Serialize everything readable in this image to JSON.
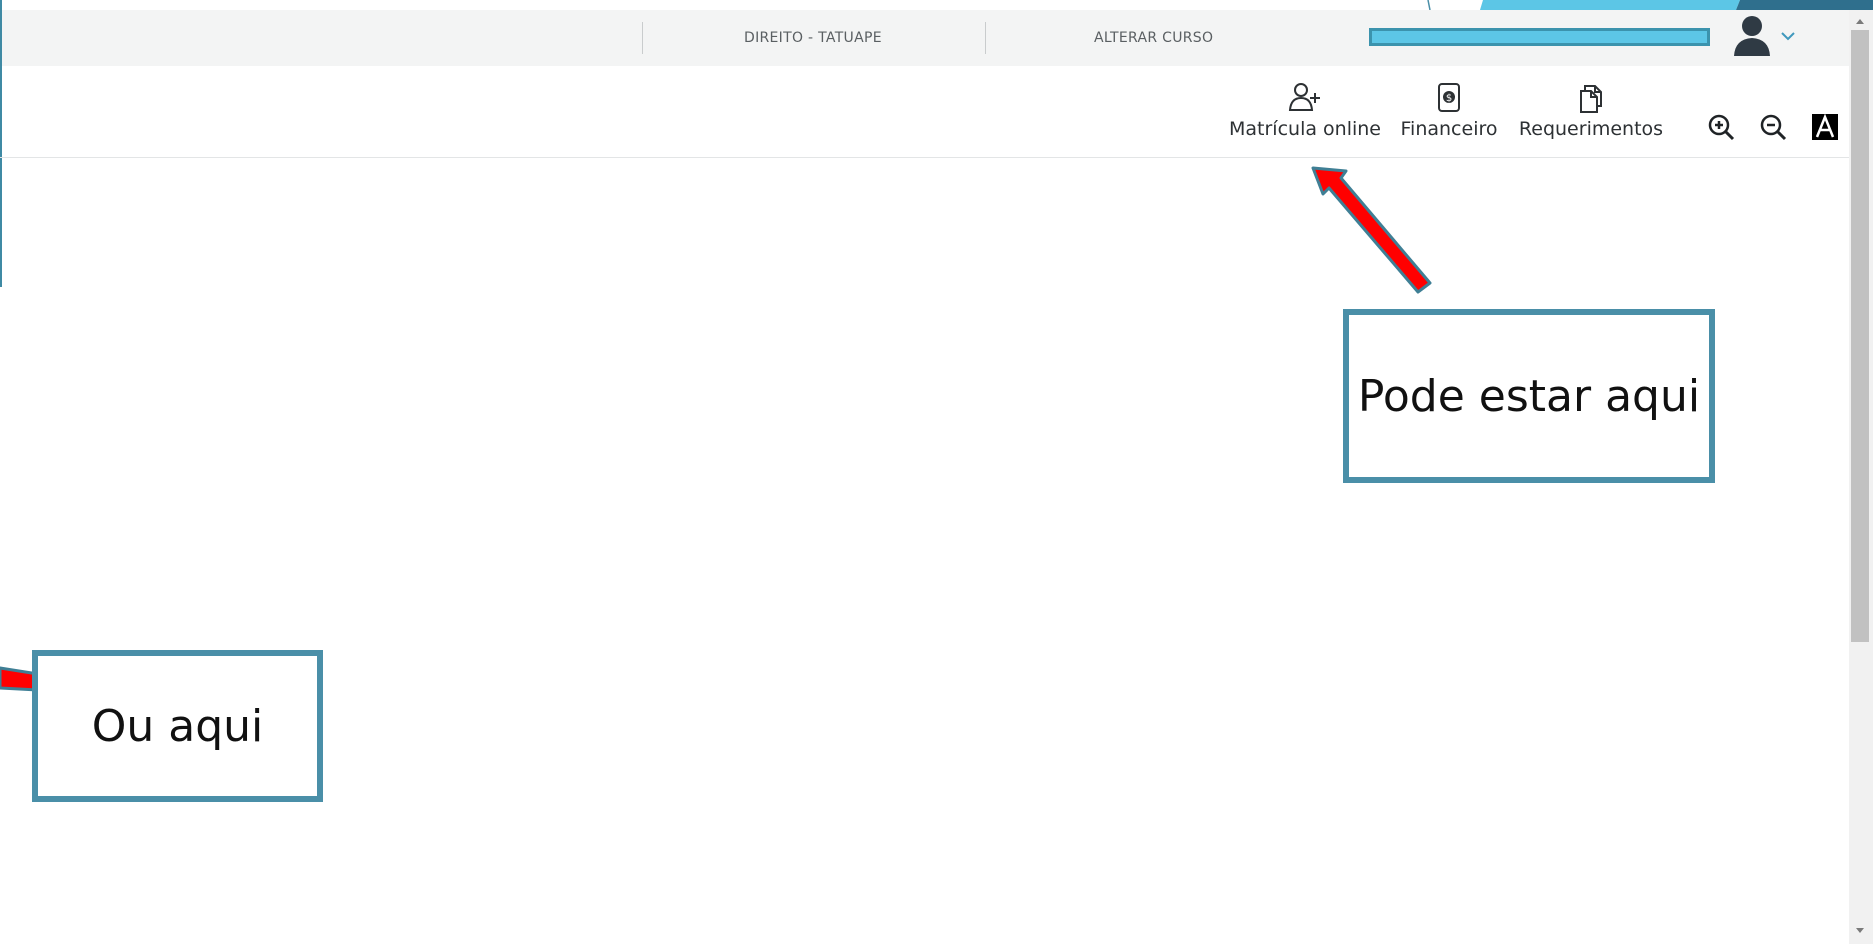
{
  "header": {
    "course_name": "DIREITO - TATUAPE",
    "change_course_label": "ALTERAR CURSO"
  },
  "toolbar": {
    "enrollment_label": "Matrícula online",
    "financial_label": "Financeiro",
    "requests_label": "Requerimentos",
    "icons": {
      "enrollment": "person-add-icon",
      "financial": "money-document-icon",
      "requests": "documents-icon",
      "zoom_in": "zoom-in-icon",
      "zoom_out": "zoom-out-icon",
      "contrast": "font-contrast-icon",
      "avatar": "user-avatar-icon",
      "dropdown": "chevron-down-icon"
    }
  },
  "annotations": {
    "right_callout": "Pode estar aqui",
    "left_callout": "Ou aqui"
  },
  "colors": {
    "callout_border": "#4a8fa8",
    "arrow_fill": "#ff0000",
    "redaction_fill": "#5cc6e6",
    "topbar_bg": "#f3f4f4"
  }
}
